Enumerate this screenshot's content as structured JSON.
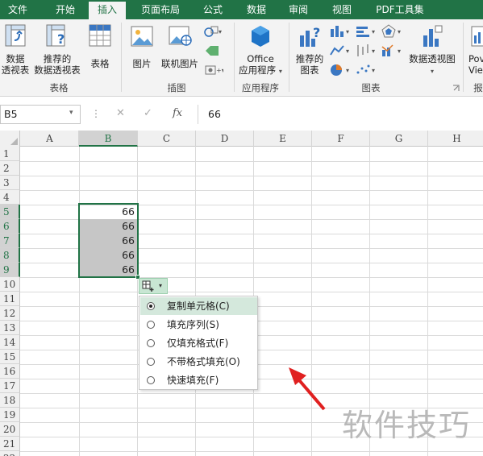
{
  "ribbon_tabs": [
    {
      "label": "文件"
    },
    {
      "label": "开始"
    },
    {
      "label": "插入",
      "active": true
    },
    {
      "label": "页面布局"
    },
    {
      "label": "公式"
    },
    {
      "label": "数据"
    },
    {
      "label": "审阅"
    },
    {
      "label": "视图"
    },
    {
      "label": "PDF工具集"
    }
  ],
  "ribbon": {
    "pivot_table": {
      "line1": "数据",
      "line2": "透视表"
    },
    "recommended_pivot": {
      "line1": "推荐的",
      "line2": "数据透视表"
    },
    "table": "表格",
    "group_tables": "表格",
    "picture": "图片",
    "online_picture": "联机图片",
    "group_illustrations": "插图",
    "office_apps": {
      "line1": "Office",
      "line2": "应用程序"
    },
    "group_apps": "应用程序",
    "recommended_charts": {
      "line1": "推荐的",
      "line2": "图表"
    },
    "group_charts": "图表",
    "pivot_chart": "数据透视图",
    "power_view": {
      "line1": "Pov",
      "line2": "Vie"
    },
    "group_reports_partial": "报"
  },
  "formula_bar": {
    "name_box": "B5",
    "fx": "fx",
    "cancel": "✕",
    "enter": "✓",
    "value": "66"
  },
  "columns": [
    "A",
    "B",
    "C",
    "D",
    "E",
    "F",
    "G",
    "H"
  ],
  "rows": [
    "1",
    "2",
    "3",
    "4",
    "5",
    "6",
    "7",
    "8",
    "9",
    "10",
    "11",
    "12",
    "13",
    "14",
    "15",
    "16",
    "17",
    "18",
    "19",
    "20",
    "21",
    "22"
  ],
  "selected_column": "B",
  "selected_rows": [
    "5",
    "6",
    "7",
    "8",
    "9"
  ],
  "cells": [
    {
      "ref": "B5",
      "value": "66"
    },
    {
      "ref": "B6",
      "value": "66"
    },
    {
      "ref": "B7",
      "value": "66"
    },
    {
      "ref": "B8",
      "value": "66"
    },
    {
      "ref": "B9",
      "value": "66"
    }
  ],
  "autofill_menu": {
    "items": [
      {
        "label": "复制单元格(C)",
        "selected": true
      },
      {
        "label": "填充序列(S)",
        "selected": false
      },
      {
        "label": "仅填充格式(F)",
        "selected": false
      },
      {
        "label": "不带格式填充(O)",
        "selected": false
      },
      {
        "label": "快速填充(F)",
        "selected": false
      }
    ]
  },
  "watermark": "软件技巧",
  "colors": {
    "excel_green": "#217346",
    "selection_shade": "#c6c6c6",
    "arrow_red": "#e02020"
  }
}
